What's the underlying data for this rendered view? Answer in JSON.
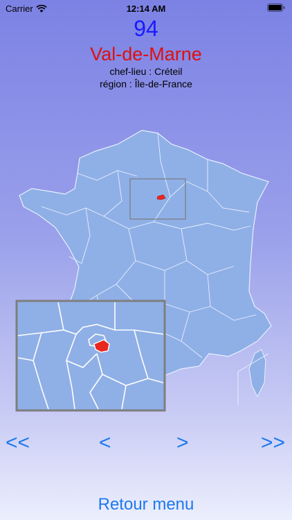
{
  "status": {
    "carrier": "Carrier",
    "time": "12:14 AM",
    "wifi_icon": "wifi-icon",
    "battery_icon": "battery-icon"
  },
  "department": {
    "number": "94",
    "name": "Val-de-Marne",
    "chef_lieu_label": "chef-lieu :",
    "chef_lieu": "Créteil",
    "region_label": "région :",
    "region": "Île-de-France"
  },
  "nav": {
    "first": "<<",
    "prev": "<",
    "next": ">",
    "last": ">>"
  },
  "menu": {
    "back": "Retour menu"
  },
  "colors": {
    "map_fill": "#8fb0e6",
    "highlight": "#e8281e",
    "number": "#1a1aff",
    "name": "#dd1010",
    "link": "#1e78f0"
  }
}
